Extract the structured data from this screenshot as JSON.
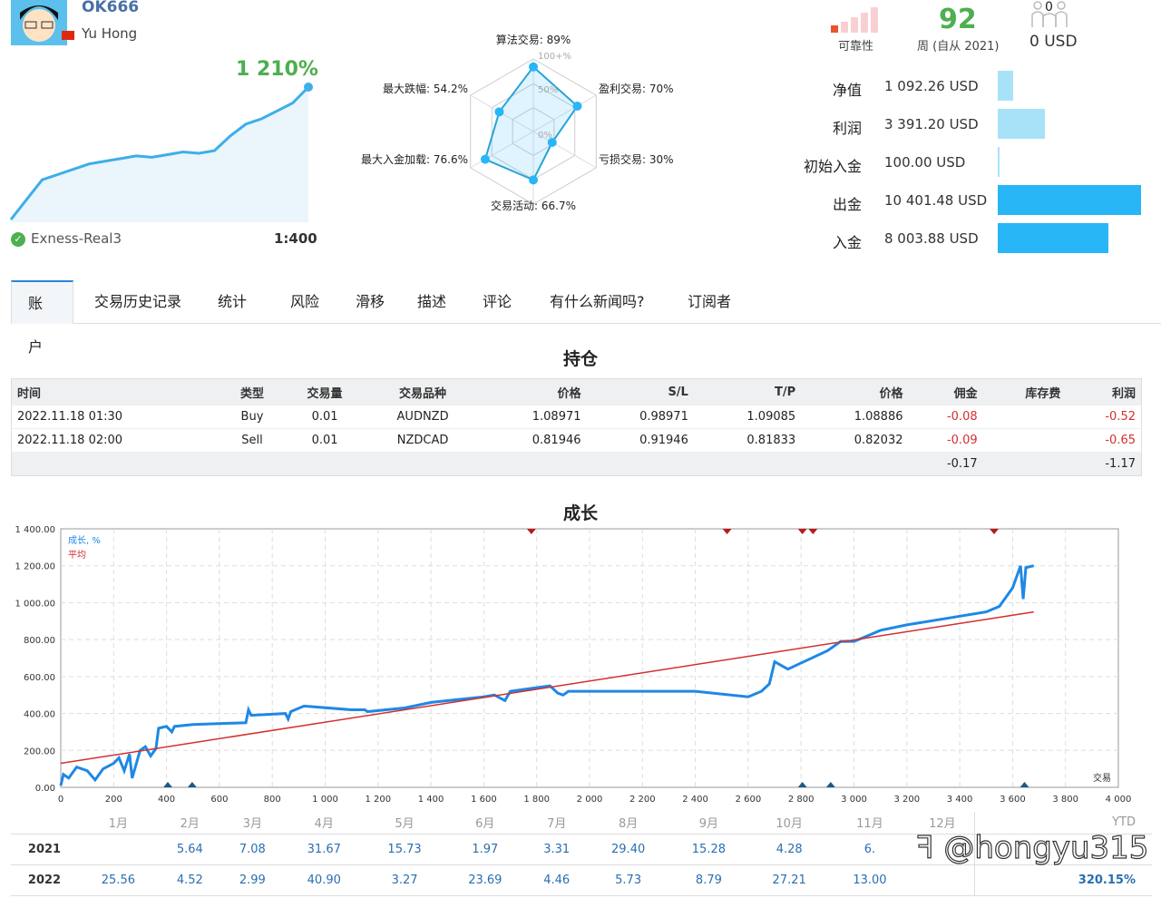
{
  "profile": {
    "login": "OK666",
    "name": "Yu Hong",
    "gain": "1 210%",
    "server": "Exness-Real3",
    "leverage": "1:400",
    "sparkline": [
      0,
      15,
      30,
      34,
      38,
      42,
      44,
      46,
      48,
      47,
      49,
      51,
      50,
      52,
      63,
      72,
      76,
      82,
      88,
      100
    ]
  },
  "radar": {
    "center_label": "0%",
    "mid_label": "50%",
    "max_label": "100+%",
    "axes": [
      {
        "label": "算法交易: 89%",
        "value": 89
      },
      {
        "label": "盈利交易: 70%",
        "value": 70
      },
      {
        "label": "亏损交易: 30%",
        "value": 30
      },
      {
        "label": "交易活动: 66.7%",
        "value": 66.7
      },
      {
        "label": "最大入金加载: 76.6%",
        "value": 76.6
      },
      {
        "label": "最大跌幅: 54.2%",
        "value": 54.2
      }
    ]
  },
  "stats": {
    "reliability_label": "可靠性",
    "reliability_level": 1,
    "weeks": "92",
    "weeks_label": "周 (自从 2021)",
    "subscribers": "0",
    "subscribers_value": "0 USD"
  },
  "finance": [
    {
      "label": "净值",
      "value": "1 092.26 USD",
      "amount": 1092.26,
      "color": "#a8e2f9"
    },
    {
      "label": "利润",
      "value": "3 391.20 USD",
      "amount": 3391.2,
      "color": "#a8e2f9"
    },
    {
      "label": "初始入金",
      "value": "100.00 USD",
      "amount": 100.0,
      "color": "#a8e2f9"
    },
    {
      "label": "出金",
      "value": "10 401.48 USD",
      "amount": 10401.48,
      "color": "#29b6f6"
    },
    {
      "label": "入金",
      "value": "8 003.88 USD",
      "amount": 8003.88,
      "color": "#29b6f6"
    }
  ],
  "tabs": [
    "账户",
    "交易历史记录",
    "统计",
    "风险",
    "滑移",
    "描述",
    "评论",
    "有什么新闻吗?",
    "订阅者"
  ],
  "positions": {
    "title": "持仓",
    "headers": [
      "时间",
      "类型",
      "交易量",
      "交易品种",
      "价格",
      "S/L",
      "T/P",
      "价格",
      "佣金",
      "库存费",
      "利润"
    ],
    "rows": [
      [
        "2022.11.18 01:30",
        "Buy",
        "0.01",
        "AUDNZD",
        "1.08971",
        "0.98971",
        "1.09085",
        "1.08886",
        "-0.08",
        "",
        "-0.52"
      ],
      [
        "2022.11.18 02:00",
        "Sell",
        "0.01",
        "NZDCAD",
        "0.81946",
        "0.91946",
        "0.81833",
        "0.82032",
        "-0.09",
        "",
        "-0.65"
      ]
    ],
    "totals": {
      "commission": "-0.17",
      "profit": "-1.17"
    }
  },
  "chart_data": {
    "type": "line",
    "title": "成长",
    "xlim": [
      0,
      4000
    ],
    "ylim": [
      0,
      1400
    ],
    "grid": true,
    "legend": "top-left",
    "xlabel": "交易",
    "x_ticks": [
      "0",
      "200",
      "400",
      "600",
      "800",
      "1 000",
      "1 200",
      "1 400",
      "1 600",
      "1 800",
      "2 000",
      "2 200",
      "2 400",
      "2 600",
      "2 800",
      "3 000",
      "3 200",
      "3 400",
      "3 600",
      "3 800",
      "4 000"
    ],
    "y_ticks": [
      "0.00",
      "200.00",
      "400.00",
      "600.00",
      "800.00",
      "1 000.00",
      "1 200.00",
      "1 400.00"
    ],
    "series": [
      {
        "name": "成长, %",
        "color": "#1e88e5",
        "points": [
          [
            0,
            10
          ],
          [
            10,
            70
          ],
          [
            30,
            50
          ],
          [
            60,
            110
          ],
          [
            100,
            90
          ],
          [
            130,
            40
          ],
          [
            160,
            100
          ],
          [
            200,
            130
          ],
          [
            220,
            160
          ],
          [
            240,
            90
          ],
          [
            260,
            180
          ],
          [
            270,
            50
          ],
          [
            300,
            200
          ],
          [
            320,
            220
          ],
          [
            340,
            170
          ],
          [
            360,
            210
          ],
          [
            370,
            320
          ],
          [
            400,
            330
          ],
          [
            420,
            300
          ],
          [
            430,
            330
          ],
          [
            500,
            340
          ],
          [
            700,
            350
          ],
          [
            710,
            420
          ],
          [
            720,
            390
          ],
          [
            850,
            400
          ],
          [
            860,
            370
          ],
          [
            870,
            410
          ],
          [
            920,
            440
          ],
          [
            1100,
            420
          ],
          [
            1150,
            420
          ],
          [
            1160,
            410
          ],
          [
            1300,
            430
          ],
          [
            1400,
            460
          ],
          [
            1600,
            490
          ],
          [
            1640,
            500
          ],
          [
            1680,
            470
          ],
          [
            1700,
            520
          ],
          [
            1850,
            550
          ],
          [
            1880,
            510
          ],
          [
            1900,
            500
          ],
          [
            1920,
            520
          ],
          [
            2000,
            520
          ],
          [
            2400,
            520
          ],
          [
            2600,
            490
          ],
          [
            2650,
            520
          ],
          [
            2680,
            560
          ],
          [
            2700,
            680
          ],
          [
            2750,
            640
          ],
          [
            2900,
            740
          ],
          [
            2950,
            790
          ],
          [
            3000,
            790
          ],
          [
            3050,
            820
          ],
          [
            3100,
            850
          ],
          [
            3200,
            880
          ],
          [
            3500,
            950
          ],
          [
            3550,
            980
          ],
          [
            3600,
            1080
          ],
          [
            3630,
            1200
          ],
          [
            3640,
            1020
          ],
          [
            3650,
            1190
          ],
          [
            3680,
            1200
          ]
        ]
      },
      {
        "name": "平均",
        "color": "#d32f2f",
        "points": [
          [
            0,
            130
          ],
          [
            3680,
            950
          ]
        ]
      }
    ],
    "withdrawals": [
      1780,
      2520,
      2805,
      2845,
      3530
    ],
    "deposits": [
      405,
      497,
      2805,
      2912,
      3645
    ]
  },
  "monthly": {
    "headers": [
      "",
      "1月",
      "2月",
      "3月",
      "4月",
      "5月",
      "6月",
      "7月",
      "8月",
      "9月",
      "10月",
      "11月",
      "12月",
      "YTD"
    ],
    "rows": [
      [
        "2021",
        "",
        "5.64",
        "7.08",
        "31.67",
        "15.73",
        "1.97",
        "3.31",
        "29.40",
        "15.28",
        "4.28",
        "6.",
        "",
        ""
      ],
      [
        "2022",
        "25.56",
        "4.52",
        "2.99",
        "40.90",
        "3.27",
        "23.69",
        "4.46",
        "5.73",
        "8.79",
        "27.21",
        "13.00",
        "",
        "320.15%"
      ]
    ]
  },
  "watermark": "@hongyu315"
}
